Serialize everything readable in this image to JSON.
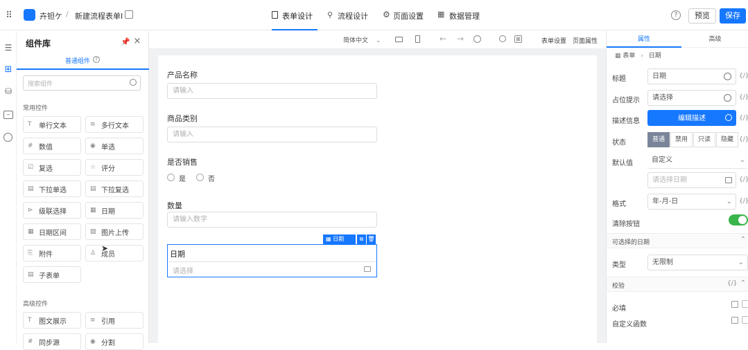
{
  "topbar": {
    "app_name": "卉钽ケ",
    "flow_name": "新建流程表单I",
    "tabs": [
      {
        "label": "表单设计",
        "active": true
      },
      {
        "label": "流程设计",
        "active": false
      },
      {
        "label": "页面设置",
        "active": false
      },
      {
        "label": "数据管理",
        "active": false
      }
    ],
    "help": "?",
    "preview_label": "预览",
    "save_label": "保存",
    "accent": "#1677ff"
  },
  "library": {
    "title": "组件库",
    "tab_label": "普通组件",
    "search_placeholder": "搜索组件",
    "group1_title": "常用控件",
    "group1": [
      "单行文本",
      "多行文本",
      "数值",
      "单选",
      "复选",
      "评分",
      "下拉单选",
      "下拉复选",
      "级联选择",
      "日期",
      "日期区间",
      "图片上传",
      "附件",
      "成员",
      "子表单"
    ],
    "group2_title": "高级控件",
    "group2": [
      "图文展示",
      "引用",
      "同步源",
      "分割"
    ]
  },
  "canvas_toolbar": {
    "lang": "简体中文",
    "form_settings": "表单设置",
    "page_props": "页面属性"
  },
  "form": {
    "fields": [
      {
        "label": "产品名称",
        "placeholder": "请输入"
      },
      {
        "label": "商品类别",
        "placeholder": "请输入"
      },
      {
        "label": "是否销售",
        "options": [
          "是",
          "否"
        ]
      },
      {
        "label": "数量",
        "placeholder": "请输入数字"
      }
    ],
    "selected": {
      "label": "日期",
      "placeholder": "请选择",
      "toolbar_label": "日期"
    }
  },
  "props": {
    "tabs": [
      "属性",
      "高级"
    ],
    "breadcrumb": [
      "表单",
      "日期"
    ],
    "rows": {
      "title_label": "标题",
      "title_value": "日期",
      "placeholder_label": "占位提示",
      "placeholder_value": "请选择",
      "desc_label": "描述信息",
      "desc_button": "编辑描述",
      "state_label": "状态",
      "states": [
        "普通",
        "禁用",
        "只读",
        "隐藏"
      ],
      "default_label": "默认值",
      "default_value": "自定义",
      "date_placeholder": "请选择日期",
      "format_label": "格式",
      "format_value": "年-月-日",
      "clear_label": "清除按钮",
      "range_section": "可选择的日期",
      "type_label": "类型",
      "type_value": "无限制",
      "validate_section": "校验",
      "required_label": "必填",
      "custom_func_label": "自定义函数"
    },
    "fx": "{/}"
  }
}
